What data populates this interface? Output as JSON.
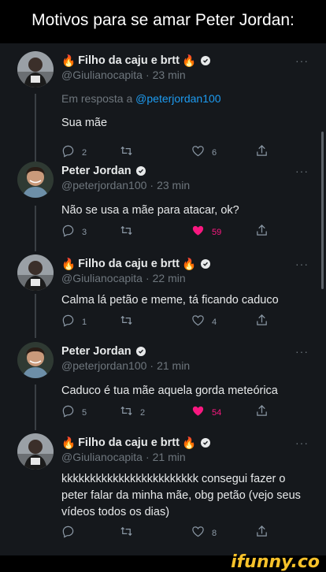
{
  "header": {
    "title": "Motivos para se amar Peter Jordan:"
  },
  "colors": {
    "background": "#15181c",
    "muted": "#6e767d",
    "link": "#1d9bf0",
    "like": "#f91880",
    "watermark": "#f7c22a"
  },
  "tweets": [
    {
      "name": "Filho da caju e brtt",
      "handle": "@Giulianocapita",
      "time": "23 min",
      "reply_prefix": "Em resposta a",
      "reply_to": "@peterjordan100",
      "text": "Sua mãe",
      "replies": "2",
      "retweets": "",
      "likes": "6",
      "liked": false
    },
    {
      "name": "Peter Jordan",
      "handle": "@peterjordan100",
      "time": "23 min",
      "text": "Não se usa a mãe para atacar, ok?",
      "replies": "3",
      "retweets": "",
      "likes": "59",
      "liked": true
    },
    {
      "name": "Filho da caju e brtt",
      "handle": "@Giulianocapita",
      "time": "22 min",
      "text": "Calma lá petão e meme, tá ficando caduco",
      "replies": "1",
      "retweets": "",
      "likes": "4",
      "liked": false
    },
    {
      "name": "Peter Jordan",
      "handle": "@peterjordan100",
      "time": "21 min",
      "text": "Caduco é tua mãe aquela gorda meteórica",
      "replies": "5",
      "retweets": "2",
      "likes": "54",
      "liked": true
    },
    {
      "name": "Filho da caju e brtt",
      "handle": "@Giulianocapita",
      "time": "21 min",
      "text": "kkkkkkkkkkkkkkkkkkkkkkkk consegui fazer o peter falar da minha mãe, obg petão (vejo seus vídeos todos os dias)",
      "replies": "",
      "retweets": "",
      "likes": "8",
      "liked": false
    }
  ],
  "separator": "·",
  "more_label": "···",
  "watermark": {
    "text": "ifunny.co"
  }
}
